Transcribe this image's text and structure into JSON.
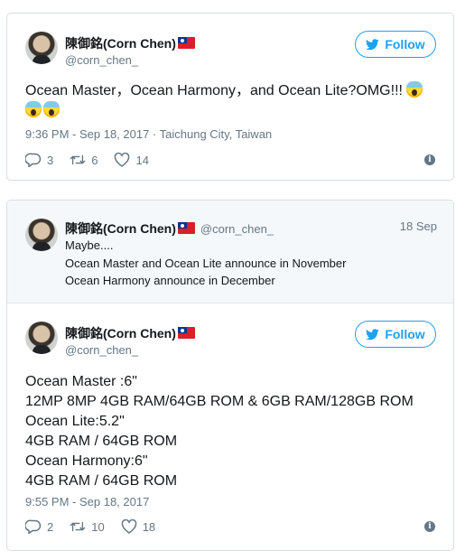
{
  "tweet1": {
    "user_name": "陳御銘(Corn Chen)",
    "handle": "@corn_chen_",
    "follow_label": "Follow",
    "text_line1": "Ocean Master，Ocean Harmony，and Ocean Lite?OMG!!!",
    "timestamp": "9:36 PM - Sep 18, 2017 · Taichung City, Taiwan",
    "replies": "3",
    "retweets": "6",
    "likes": "14"
  },
  "tweet2": {
    "quoted": {
      "user_name": "陳御銘(Corn Chen)",
      "handle": "@corn_chen_",
      "date": "18 Sep",
      "lines": [
        "Maybe....",
        "Ocean Master and Ocean Lite announce in November",
        "Ocean Harmony announce in December"
      ]
    },
    "user_name": "陳御銘(Corn Chen)",
    "handle": "@corn_chen_",
    "follow_label": "Follow",
    "lines": [
      "Ocean Master :6\"",
      "12MP 8MP 4GB RAM/64GB ROM & 6GB RAM/128GB ROM",
      "Ocean Lite:5.2\"",
      "4GB RAM / 64GB ROM",
      "Ocean Harmony:6\"",
      "4GB RAM / 64GB ROM"
    ],
    "timestamp": "9:55 PM - Sep 18, 2017",
    "replies": "2",
    "retweets": "10",
    "likes": "18"
  },
  "icons": {
    "reply": "reply-icon",
    "retweet": "retweet-icon",
    "like": "heart-icon",
    "info": "info-icon",
    "bird": "twitter-bird-icon"
  },
  "colors": {
    "accent": "#1da1f2",
    "muted": "#657786",
    "text": "#14171a"
  }
}
